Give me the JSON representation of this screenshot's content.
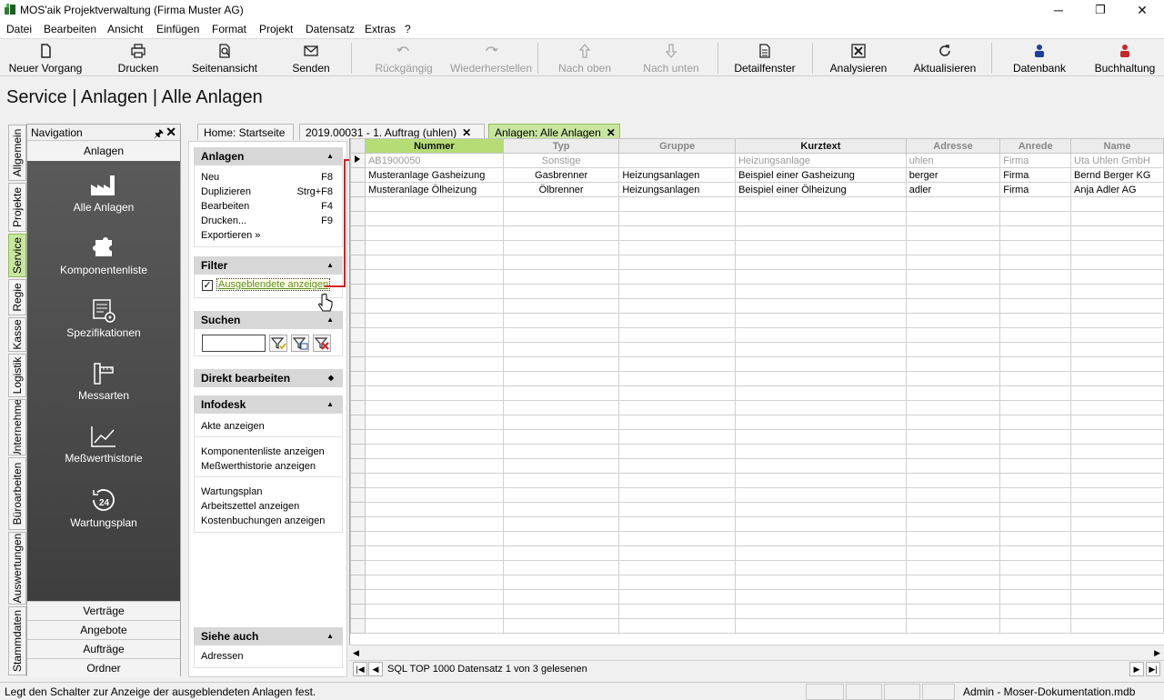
{
  "window": {
    "title": "MOS'aik Projektverwaltung (Firma Muster AG)",
    "minimize": "─",
    "restore": "❐",
    "close": "✕"
  },
  "menu": [
    "Datei",
    "Bearbeiten",
    "Ansicht",
    "Einfügen",
    "Format",
    "Projekt",
    "Datensatz",
    "Extras",
    "?"
  ],
  "toolbar": {
    "neuer_vorgang": "Neuer Vorgang",
    "drucken": "Drucken",
    "seitenansicht": "Seitenansicht",
    "senden": "Senden",
    "rueckgaengig": "Rückgängig",
    "wiederherstellen": "Wiederherstellen",
    "nach_oben": "Nach oben",
    "nach_unten": "Nach unten",
    "detailfenster": "Detailfenster",
    "analysieren": "Analysieren",
    "aktualisieren": "Aktualisieren",
    "datenbank": "Datenbank",
    "buchhaltung": "Buchhaltung"
  },
  "page_title": "Service | Anlagen | Alle Anlagen",
  "vertical_tabs": [
    "Allgemein",
    "Projekte",
    "Service",
    "Regie",
    "Kasse",
    "Logistik",
    "Unternehmer",
    "Büroarbeiten",
    "Auswertungen",
    "Stammdaten"
  ],
  "navigation": {
    "header": "Navigation",
    "pin": "🖈",
    "close": "✕",
    "section_top": "Anlagen",
    "items": [
      "Alle Anlagen",
      "Komponentenliste",
      "Spezifikationen",
      "Messarten",
      "Meßwerthistorie",
      "Wartungsplan"
    ],
    "sections_bottom": [
      "Verträge",
      "Angebote",
      "Aufträge",
      "Ordner"
    ]
  },
  "taskpane": {
    "anlagen": {
      "title": "Anlagen",
      "items": [
        {
          "label": "Neu",
          "shortcut": "F8"
        },
        {
          "label": "Duplizieren",
          "shortcut": "Strg+F8"
        },
        {
          "label": "Bearbeiten",
          "shortcut": "F4"
        },
        {
          "label": "Drucken...",
          "shortcut": "F9"
        },
        {
          "label": "Exportieren »",
          "shortcut": ""
        }
      ]
    },
    "filter": {
      "title": "Filter",
      "checkbox_label": "Ausgeblendete anzeigen",
      "checked": true
    },
    "suchen": {
      "title": "Suchen",
      "value": ""
    },
    "direkt": {
      "title": "Direkt bearbeiten"
    },
    "infodesk": {
      "title": "Infodesk",
      "items": [
        "Akte anzeigen",
        "Komponentenliste anzeigen",
        "Meßwerthistorie anzeigen",
        "Wartungsplan",
        "Arbeitszettel anzeigen",
        "Kostenbuchungen anzeigen"
      ]
    },
    "siehe_auch": {
      "title": "Siehe auch",
      "items": [
        "Adressen"
      ]
    }
  },
  "doc_tabs": [
    {
      "label": "Home: Startseite"
    },
    {
      "label": "2019.00031 - 1. Auftrag (uhlen)"
    },
    {
      "label": "Anlagen: Alle Anlagen"
    }
  ],
  "grid": {
    "columns": [
      "Nummer",
      "Typ",
      "Gruppe",
      "Kurztext",
      "Adresse",
      "Anrede",
      "Name"
    ],
    "new_row": [
      "AB1900050",
      "Sonstige",
      "",
      "Heizungsanlage",
      "uhlen",
      "Firma",
      "Uta Uhlen GmbH"
    ],
    "rows": [
      [
        "Musteranlage Gasheizung",
        "Gasbrenner",
        "Heizungsanlagen",
        "Beispiel einer Gasheizung",
        "berger",
        "Firma",
        "Bernd Berger KG"
      ],
      [
        "Musteranlage Ölheizung",
        "Ölbrenner",
        "Heizungsanlagen",
        "Beispiel einer Ölheizung",
        "adler",
        "Firma",
        "Anja Adler AG"
      ]
    ]
  },
  "navigator": {
    "status": "SQL TOP 1000 Datensatz 1 von 3 gelesenen",
    "first": "|◀",
    "prev": "◀",
    "next": "▶",
    "last": "▶|"
  },
  "statusbar": {
    "message": "Legt den Schalter zur Anzeige der ausgeblendeten Anlagen fest.",
    "user": "Admin - Moser-Dokumentation.mdb"
  }
}
